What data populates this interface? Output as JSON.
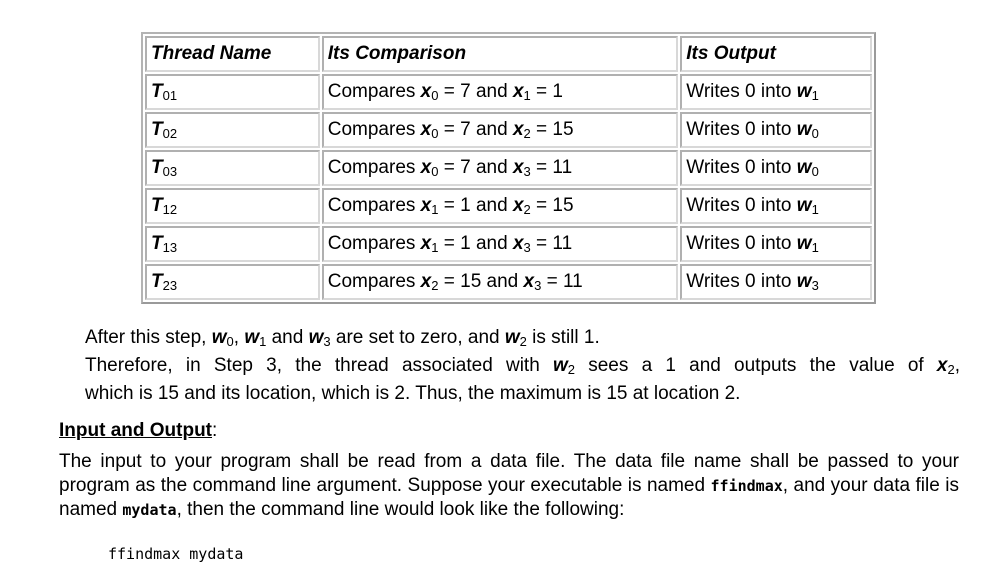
{
  "table": {
    "headers": [
      "Thread Name",
      "Its Comparison",
      "Its Output"
    ],
    "rows": [
      {
        "thread": "T",
        "thread_sub": "01",
        "cmp_prefix": "Compares ",
        "a_var": "x",
        "a_sub": "0",
        "a_val": " = 7 and ",
        "b_var": "x",
        "b_sub": "1",
        "b_val": " = 1",
        "out_prefix": "Writes 0 into ",
        "w_var": "w",
        "w_sub": "1"
      },
      {
        "thread": "T",
        "thread_sub": "02",
        "cmp_prefix": "Compares ",
        "a_var": "x",
        "a_sub": "0",
        "a_val": " = 7 and ",
        "b_var": "x",
        "b_sub": "2",
        "b_val": " = 15",
        "out_prefix": "Writes 0 into ",
        "w_var": "w",
        "w_sub": "0"
      },
      {
        "thread": "T",
        "thread_sub": "03",
        "cmp_prefix": "Compares ",
        "a_var": "x",
        "a_sub": "0",
        "a_val": " = 7 and ",
        "b_var": "x",
        "b_sub": "3",
        "b_val": " = 11",
        "out_prefix": "Writes 0 into ",
        "w_var": "w",
        "w_sub": "0"
      },
      {
        "thread": "T",
        "thread_sub": "12",
        "cmp_prefix": "Compares ",
        "a_var": "x",
        "a_sub": "1",
        "a_val": " = 1 and ",
        "b_var": "x",
        "b_sub": "2",
        "b_val": " = 15",
        "out_prefix": "Writes 0 into ",
        "w_var": "w",
        "w_sub": "1"
      },
      {
        "thread": "T",
        "thread_sub": "13",
        "cmp_prefix": "Compares ",
        "a_var": "x",
        "a_sub": "1",
        "a_val": " = 1 and ",
        "b_var": "x",
        "b_sub": "3",
        "b_val": " = 11",
        "out_prefix": "Writes 0 into ",
        "w_var": "w",
        "w_sub": "1"
      },
      {
        "thread": "T",
        "thread_sub": "23",
        "cmp_prefix": "Compares ",
        "a_var": "x",
        "a_sub": "2",
        "a_val": " = 15 and ",
        "b_var": "x",
        "b_sub": "3",
        "b_val": " = 11",
        "out_prefix": "Writes 0 into ",
        "w_var": "w",
        "w_sub": "3"
      }
    ]
  },
  "para1": {
    "line1": {
      "t1": "After this step, ",
      "v1": "w",
      "s1": "0",
      "t2": ", ",
      "v2": "w",
      "s2": "1",
      "t3": " and ",
      "v3": "w",
      "s3": "3",
      "t4": " are set to zero, and ",
      "v4": "w",
      "s4": "2",
      "t5": " is still 1."
    },
    "line2": {
      "t1": "Therefore, in Step 3, the thread associated with ",
      "v1": "w",
      "s1": "2",
      "t2": " sees a 1 and outputs the value of ",
      "v2": "x",
      "s2": "2",
      "t3": ","
    },
    "line3": "which is 15 and its location, which is 2. Thus, the maximum is 15 at location 2."
  },
  "section": {
    "heading": "Input and Output",
    "heading_colon": ":",
    "p1": "The input to your program shall be read from a data file. The data file name shall be passed to your program as the command line argument. Suppose your executable is named ",
    "exe": "ffindmax",
    "p2": ", and your data file is named ",
    "datafile": "mydata",
    "p3": ", then the command line would look like the following:",
    "command": "ffindmax mydata"
  }
}
